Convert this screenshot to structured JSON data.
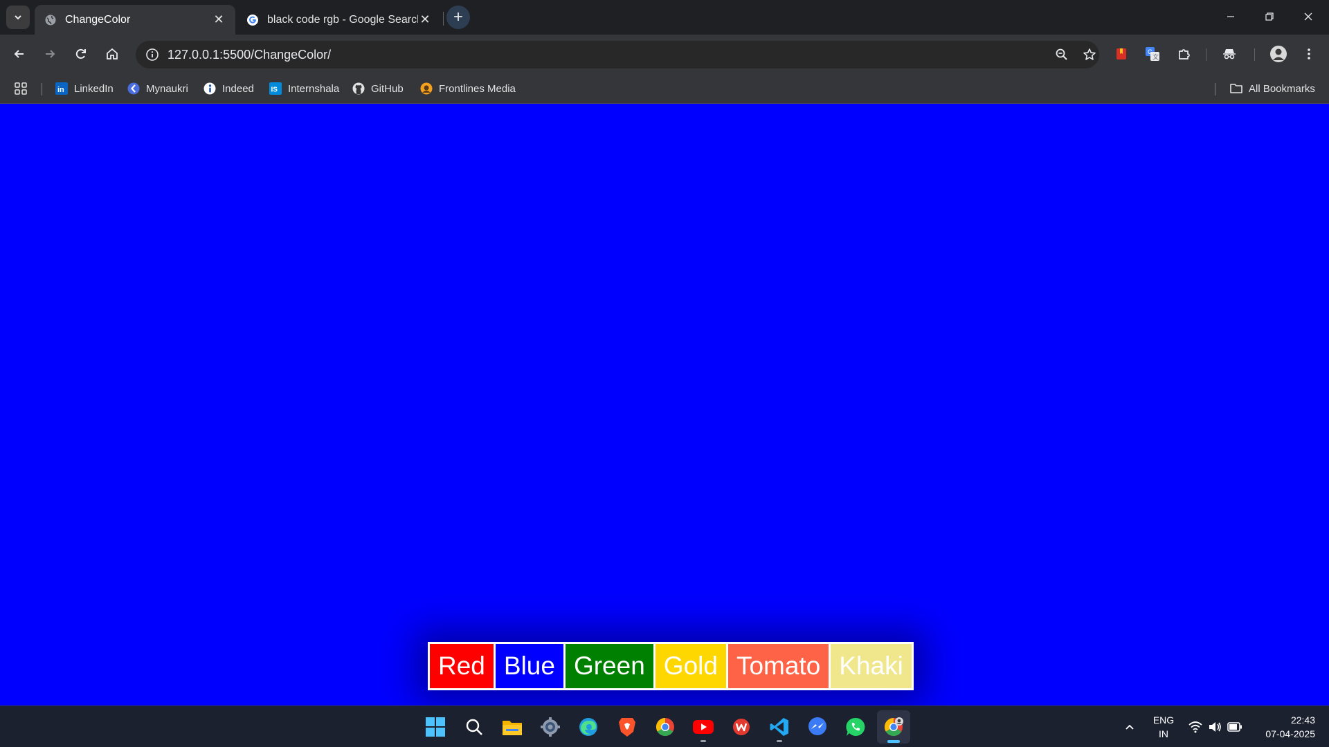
{
  "browser": {
    "tabs": [
      {
        "title": "ChangeColor",
        "active": true,
        "favicon": "globe-icon"
      },
      {
        "title": "black code rgb - Google Search",
        "active": false,
        "favicon": "google-icon"
      }
    ],
    "new_tab": "+",
    "url": "127.0.0.1:5500/ChangeColor/"
  },
  "bookmarks": {
    "items": [
      {
        "label": "LinkedIn",
        "icon": "linkedin-icon"
      },
      {
        "label": "Mynaukri",
        "icon": "mynaukri-icon"
      },
      {
        "label": "Indeed",
        "icon": "indeed-icon"
      },
      {
        "label": "Internshala",
        "icon": "internshala-icon"
      },
      {
        "label": "GitHub",
        "icon": "github-icon"
      },
      {
        "label": "Frontlines Media",
        "icon": "frontlines-icon"
      }
    ],
    "all_bookmarks": "All Bookmarks"
  },
  "page": {
    "background": "#0000ff",
    "buttons": [
      {
        "label": "Red",
        "color": "#ff0000"
      },
      {
        "label": "Blue",
        "color": "#0000ff"
      },
      {
        "label": "Green",
        "color": "#008000"
      },
      {
        "label": "Gold",
        "color": "#ffd700"
      },
      {
        "label": "Tomato",
        "color": "#ff6347"
      },
      {
        "label": "Khaki",
        "color": "#f0e68c"
      }
    ]
  },
  "taskbar": {
    "apps": [
      "windows-start-icon",
      "search-icon",
      "file-explorer-icon",
      "settings-icon",
      "edge-icon",
      "brave-icon",
      "chrome-icon",
      "youtube-icon",
      "wps-office-icon",
      "vscode-icon",
      "messenger-icon",
      "whatsapp-icon",
      "chrome-profile-icon"
    ],
    "language": "ENG",
    "region": "IN",
    "time": "22:43",
    "date": "07-04-2025"
  }
}
